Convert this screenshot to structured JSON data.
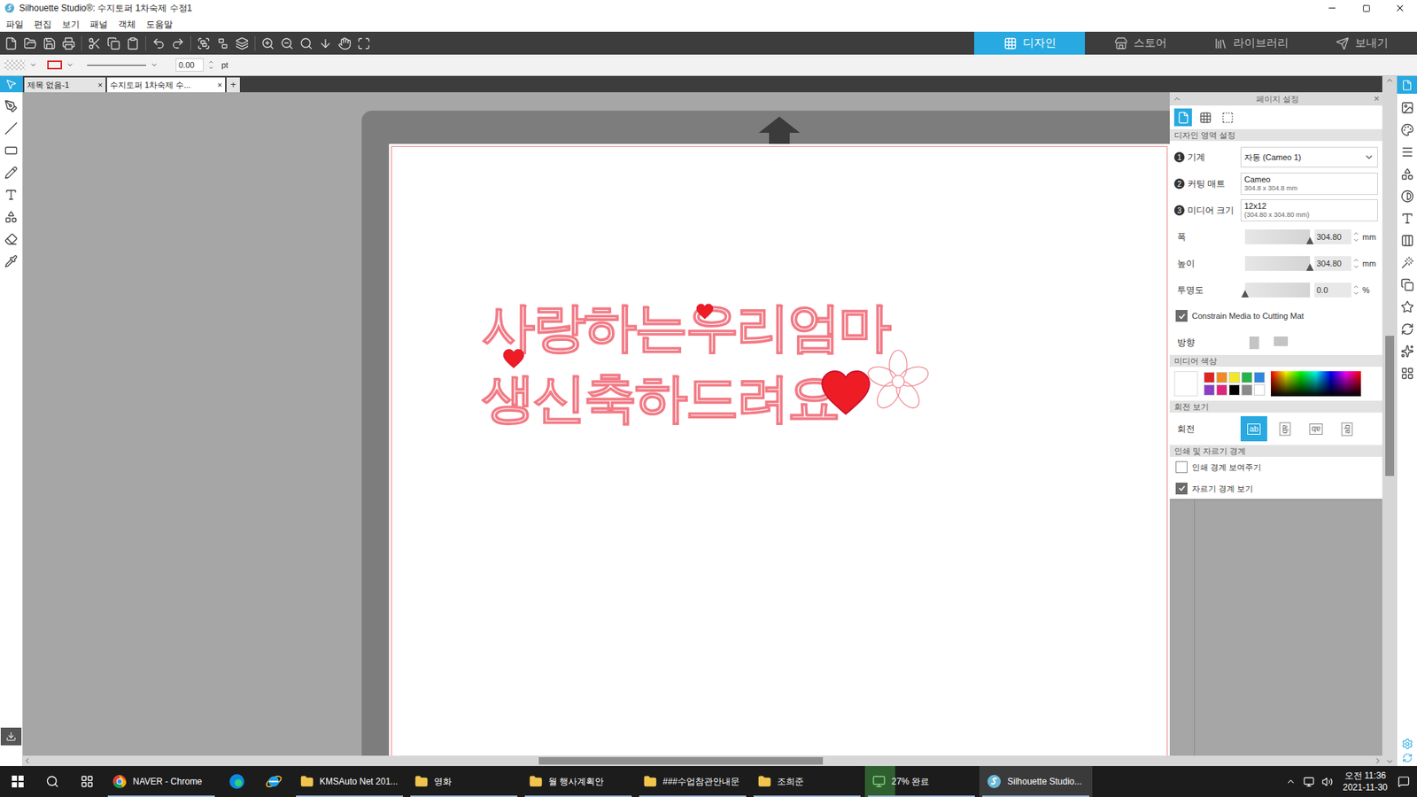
{
  "window": {
    "title": "Silhouette Studio®: 수지토퍼 1차숙제 수정1"
  },
  "menu": [
    "파일",
    "편집",
    "보기",
    "패널",
    "객체",
    "도움말"
  ],
  "mode_tabs": [
    {
      "label": "디자인",
      "selected": true
    },
    {
      "label": "스토어",
      "selected": false
    },
    {
      "label": "라이브러리",
      "selected": false
    },
    {
      "label": "보내기",
      "selected": false
    }
  ],
  "line_props": {
    "width": "0.00",
    "unit": "pt"
  },
  "doc_tabs": [
    {
      "label": "제목 없음-1",
      "close": "×",
      "selected": false
    },
    {
      "label": "수지토퍼 1차숙제 수...",
      "close": "×",
      "selected": true
    }
  ],
  "new_tab": "+",
  "design": {
    "lines": [
      "사랑하는우리엄마",
      "생신축하드려요"
    ]
  },
  "panel": {
    "title": "페이지 설정",
    "close": "×",
    "view_tabs": [
      {
        "selected": true
      },
      {
        "selected": false
      },
      {
        "selected": false
      }
    ],
    "design_area": {
      "header": "디자인 영역 설정",
      "rows": [
        {
          "num": "1",
          "label": "기계",
          "value": "자동 (Cameo 1)",
          "sub": "",
          "kind": "dropdown"
        },
        {
          "num": "2",
          "label": "커팅 매트",
          "value": "Cameo",
          "sub": "304.8 x 304.8 mm",
          "kind": "field"
        },
        {
          "num": "3",
          "label": "미디어 크기",
          "value": "12x12",
          "sub": "(304.80 x 304.80 mm)",
          "kind": "field"
        }
      ]
    },
    "sliders": [
      {
        "label": "폭",
        "value": "304.80",
        "unit": "mm",
        "level": 1
      },
      {
        "label": "높이",
        "value": "304.80",
        "unit": "mm",
        "level": 1
      },
      {
        "label": "투명도",
        "value": "0.0",
        "unit": "%",
        "level": 0
      }
    ],
    "constrain": {
      "label": "Constrain Media to Cutting Mat",
      "checked": true
    },
    "orientation": {
      "label": "방향",
      "options": [
        {
          "selected": false
        },
        {
          "selected": false
        }
      ]
    },
    "media_color": {
      "header": "미디어 색상",
      "current": "#ffffff",
      "swatches": [
        "#e02424",
        "#f08a24",
        "#f2e829",
        "#27b24a",
        "#2f86e0",
        "#8a3fc6",
        "#e0247e",
        "#000000",
        "#8a8a8a",
        "#ffffff"
      ]
    },
    "rotation": {
      "header": "회전 보기",
      "label": "회전",
      "options": [
        {
          "label": "ab",
          "selected": true
        },
        {
          "label": "ab",
          "selected": false
        },
        {
          "label": "ab",
          "selected": false
        },
        {
          "label": "ab",
          "selected": false
        }
      ]
    },
    "borders": {
      "header": "인쇄 및 자르기 경계",
      "options": [
        {
          "label": "인쇄 경계 보여주기",
          "checked": false
        },
        {
          "label": "자르기 경계 보기",
          "checked": true
        }
      ]
    }
  },
  "taskbar": {
    "apps": [
      {
        "kind": "chrome",
        "label": "NAVER - Chrome",
        "running": true,
        "selected": false,
        "level": 0
      },
      {
        "kind": "edge",
        "label": "",
        "running": false,
        "selected": false,
        "level": 0
      },
      {
        "kind": "ie",
        "label": "",
        "running": false,
        "selected": false,
        "level": 0
      },
      {
        "kind": "doc",
        "label": "KMSAuto Net 201...",
        "running": true,
        "selected": false,
        "level": 0
      },
      {
        "kind": "folder",
        "label": "영화",
        "running": true,
        "selected": false,
        "level": 0
      },
      {
        "kind": "folder",
        "label": "월 행사계획안",
        "running": true,
        "selected": false,
        "level": 0
      },
      {
        "kind": "folder",
        "label": "###수업참관안내문",
        "running": true,
        "selected": false,
        "level": 0
      },
      {
        "kind": "folder",
        "label": "조희준",
        "running": true,
        "selected": false,
        "level": 0
      },
      {
        "kind": "progress",
        "label": "27% 완료",
        "running": true,
        "selected": false,
        "level": 0.27
      },
      {
        "kind": "silhouette",
        "label": "Silhouette Studio...",
        "running": true,
        "selected": true,
        "level": 0
      }
    ],
    "time": "오전 11:36",
    "date": "2021-11-30"
  }
}
